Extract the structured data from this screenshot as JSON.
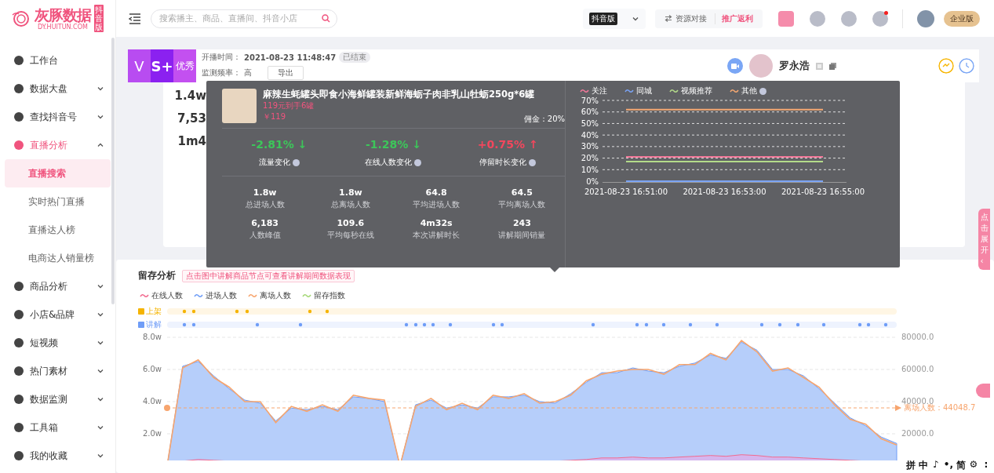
{
  "logo": {
    "name": "灰豚数据",
    "badge": "抖音版",
    "domain": "DY.HUITUN.COM"
  },
  "search": {
    "placeholder": "搜索播主、商品、直播间、抖音小店"
  },
  "topbar": {
    "platform": "抖音版",
    "resource_button": "资源对接",
    "promo_button": "推广返利",
    "edition": "企业版",
    "notification_dot": true
  },
  "sidebar": {
    "items": [
      {
        "label": "工作台",
        "kind": "link",
        "expanded": false,
        "selected": false
      },
      {
        "label": "数据大盘",
        "kind": "group",
        "expanded": false,
        "selected": false
      },
      {
        "label": "查找抖音号",
        "kind": "group",
        "expanded": false,
        "selected": false
      },
      {
        "label": "直播分析",
        "kind": "group",
        "expanded": true,
        "selected": true,
        "children": [
          {
            "label": "直播搜索",
            "selected": true
          },
          {
            "label": "实时热门直播",
            "selected": false
          },
          {
            "label": "直播达人榜",
            "selected": false
          },
          {
            "label": "电商达人销量榜",
            "selected": false
          }
        ]
      },
      {
        "label": "商品分析",
        "kind": "group",
        "expanded": false,
        "selected": false
      },
      {
        "label": "小店&品牌",
        "kind": "group",
        "expanded": false,
        "selected": false
      },
      {
        "label": "短视频",
        "kind": "group",
        "expanded": false,
        "selected": false
      },
      {
        "label": "热门素材",
        "kind": "group",
        "expanded": false,
        "selected": false
      },
      {
        "label": "数据监测",
        "kind": "group",
        "expanded": false,
        "selected": false
      },
      {
        "label": "工具箱",
        "kind": "group",
        "expanded": false,
        "selected": false
      },
      {
        "label": "我的收藏",
        "kind": "group",
        "expanded": false,
        "selected": false
      }
    ]
  },
  "live": {
    "grade": [
      "V",
      "S+",
      "优秀"
    ],
    "start_label": "开播时间：",
    "start_time": "2021-08-23 11:48:47",
    "status": "已结束",
    "freq_label": "监测频率：",
    "freq": "高",
    "export_button": "导出",
    "streamer": "罗永浩"
  },
  "stats_card": {
    "values": [
      "1.4w",
      "7,53",
      "1m4"
    ]
  },
  "tooltip": {
    "product_title": "麻辣生蚝罐头即食小海鲜罐装新鲜海蛎子肉非乳山牡蛎250g*6罐",
    "promo": "119元到手6罐",
    "price": "￥119",
    "commission": "佣金：20%",
    "changes": [
      {
        "value": "-2.81% ↓",
        "label": "流量变化",
        "kind": "down"
      },
      {
        "value": "-1.28% ↓",
        "label": "在线人数变化",
        "kind": "down"
      },
      {
        "value": "+0.75% ↑",
        "label": "停留时长变化",
        "kind": "up"
      }
    ],
    "stats": [
      {
        "value": "1.8w",
        "label": "总进场人数"
      },
      {
        "value": "1.8w",
        "label": "总离场人数"
      },
      {
        "value": "64.8",
        "label": "平均进场人数"
      },
      {
        "value": "64.5",
        "label": "平均离场人数"
      },
      {
        "value": "6,183",
        "label": "人数峰值"
      },
      {
        "value": "109.6",
        "label": "平均每秒在线"
      },
      {
        "value": "4m32s",
        "label": "本次讲解时长"
      },
      {
        "value": "243",
        "label": "讲解期间销量"
      }
    ],
    "chart_data": {
      "type": "line",
      "grid": true,
      "categories": [
        "2021-08-23 16:51:00",
        "2021-08-23 16:53:00",
        "2021-08-23 16:55:00"
      ],
      "ylim": [
        0,
        70
      ],
      "yticks": [
        {
          "value": 0,
          "label": "0%"
        },
        {
          "value": 10,
          "label": "10%"
        },
        {
          "value": 20,
          "label": "20%"
        },
        {
          "value": 30,
          "label": "30%"
        },
        {
          "value": 40,
          "label": "40%"
        },
        {
          "value": 50,
          "label": "50%"
        },
        {
          "value": 60,
          "label": "60%"
        },
        {
          "value": 70,
          "label": "70%"
        }
      ],
      "series": [
        {
          "name": "关注",
          "color": "#f2789a",
          "values": [
            21,
            21,
            21
          ]
        },
        {
          "name": "同城",
          "color": "#7aa3f5",
          "values": [
            0,
            0,
            0
          ]
        },
        {
          "name": "视频推荐",
          "color": "#b3db8a",
          "values": [
            17,
            17,
            17
          ]
        },
        {
          "name": "其他",
          "color": "#f5a872",
          "values": [
            62,
            62,
            62
          ]
        }
      ]
    }
  },
  "retention": {
    "title": "留存分析",
    "notice": "点击图中讲解商品节点可查看讲解期间数据表现",
    "timeline_rows": [
      {
        "label": "上架",
        "kind": "listing"
      },
      {
        "label": "讲解",
        "kind": "explain"
      }
    ],
    "marker_label": "离场人数：44048.7",
    "right_axis_labels": [
      "80000.0",
      "60000.0",
      "40000.0",
      "20000.0"
    ],
    "chart_data": {
      "type": "area",
      "grid": true,
      "ylim": [
        0,
        8
      ],
      "yticks": [
        {
          "value": 2,
          "label": "2.0w"
        },
        {
          "value": 4,
          "label": "4.0w"
        },
        {
          "value": 6,
          "label": "6.0w"
        },
        {
          "value": 8,
          "label": "8.0w"
        }
      ],
      "series": [
        {
          "name": "在线人数",
          "type": "area",
          "color": "#f26b8f",
          "values": [
            0,
            0.3,
            0.4,
            0.35,
            0.3,
            0.25,
            0.25,
            0.2,
            0.25,
            0.25,
            0.25,
            0.25,
            0.3,
            0.3,
            0.25,
            0,
            0.25,
            0.3,
            0.25,
            0.25,
            0.25,
            0.3,
            0.3,
            0.3,
            0.3,
            0.3,
            0.35,
            0.4,
            0.5,
            0.5,
            0.55,
            0.5,
            0.5,
            0.55,
            0.6,
            0.65,
            0.6,
            0.7,
            0.65,
            0.55,
            0.55,
            0.5,
            0.45,
            0.4,
            0.35,
            0.3,
            0.25,
            0.2
          ]
        },
        {
          "name": "进场人数",
          "type": "area",
          "color": "#6f9df7",
          "values": [
            0,
            6.2,
            6.5,
            5.6,
            4.8,
            4.1,
            3.9,
            2.8,
            3.6,
            3.5,
            3.7,
            3.5,
            4.3,
            4.2,
            4.0,
            0,
            3.8,
            4.1,
            3.6,
            3.8,
            3.6,
            4.3,
            4.3,
            4.4,
            4.0,
            3.9,
            4.5,
            5.2,
            5.8,
            5.8,
            6.1,
            5.9,
            5.8,
            6.2,
            6.4,
            6.9,
            6.7,
            7.7,
            7.2,
            6.0,
            6.0,
            5.6,
            4.8,
            3.9,
            3.0,
            2.5,
            1.8,
            1.4
          ]
        },
        {
          "name": "离场人数",
          "type": "line",
          "color": "#f7a56e",
          "values": [
            0,
            6.1,
            6.6,
            5.5,
            4.9,
            4.0,
            4.0,
            2.7,
            3.7,
            3.4,
            3.8,
            3.4,
            4.4,
            4.2,
            4.1,
            0,
            3.7,
            4.2,
            3.5,
            3.9,
            3.5,
            4.4,
            4.2,
            4.5,
            3.9,
            4.0,
            4.4,
            5.3,
            5.7,
            5.9,
            6.0,
            6.0,
            5.7,
            6.3,
            6.3,
            7.0,
            6.6,
            7.8,
            7.1,
            5.9,
            6.1,
            5.5,
            4.9,
            3.8,
            2.9,
            2.6,
            1.7,
            1.3
          ]
        },
        {
          "name": "留存指数",
          "type": "line",
          "color": "#a5d877",
          "values": [
            null,
            null,
            null
          ]
        }
      ]
    }
  },
  "side_tab": {
    "label": "点击展开",
    "arrow": "‹"
  },
  "ime_bar": [
    "拼",
    "中",
    "♪",
    "•,",
    "简",
    "⚙",
    ":"
  ]
}
